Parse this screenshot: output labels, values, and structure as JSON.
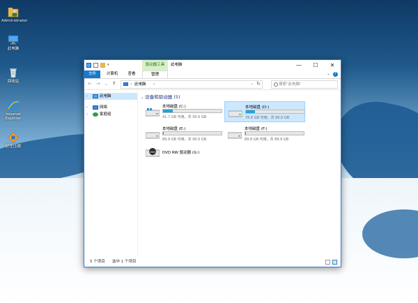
{
  "desktop": {
    "icons": [
      {
        "label": "Administrator",
        "icon": "user-folder-icon"
      },
      {
        "label": "此电脑",
        "icon": "computer-icon"
      },
      {
        "label": "回收站",
        "icon": "recycle-bin-icon"
      },
      {
        "label": "Internet Explorer",
        "icon": "internet-explorer-icon"
      },
      {
        "label": "好压压缩",
        "icon": "haozip-icon"
      }
    ]
  },
  "window": {
    "title": "此电脑",
    "context_tab": "驱动器工具",
    "ribbon_tabs": [
      "文件",
      "计算机",
      "查看",
      "管理"
    ],
    "controls": {
      "minimize": "—",
      "maximize": "☐",
      "close": "✕"
    }
  },
  "navigation": {
    "back": "←",
    "forward": "→",
    "recent": "⌄",
    "up": "↑",
    "breadcrumb": "此电脑",
    "breadcrumb_sep": "›",
    "search_placeholder": "搜索\"此电脑\""
  },
  "sidebar": {
    "items": [
      {
        "label": "此电脑",
        "selected": true,
        "icon": "computer-icon"
      },
      {
        "label": "网络",
        "selected": false,
        "icon": "network-icon"
      },
      {
        "label": "家庭组",
        "selected": false,
        "icon": "homegroup-icon"
      }
    ]
  },
  "content": {
    "group_header": "设备和驱动器 (5)",
    "drives": [
      {
        "name": "本地磁盘 (C:)",
        "info": "41.7 GB 可用，共 50.0 GB",
        "used_fraction": 0.166,
        "selected": false
      },
      {
        "name": "本地磁盘 (D:)",
        "info": "76.6 GB 可用，共 90.0 GB",
        "used_fraction": 0.149,
        "selected": true
      },
      {
        "name": "本地磁盘 (E:)",
        "info": "89.9 GB 可用，共 90.0 GB",
        "used_fraction": 0.001,
        "selected": false
      },
      {
        "name": "本地磁盘 (F:)",
        "info": "89.8 GB 可用，共 89.9 GB",
        "used_fraction": 0.001,
        "selected": false
      }
    ],
    "dvd": {
      "name": "DVD RW 驱动器 (G:)",
      "disc_label": "DVD"
    }
  },
  "statusbar": {
    "count": "5 个项目",
    "selected": "选中 1 个项目"
  },
  "colors": {
    "accent": "#1979ca",
    "selection_bg": "#cce8ff",
    "bar_fill": "#26a0da",
    "context_tab_bg": "#d8f0c8"
  }
}
